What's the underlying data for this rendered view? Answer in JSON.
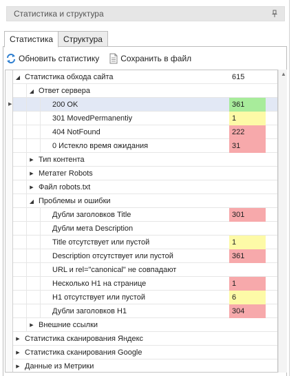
{
  "panel": {
    "title": "Статистика и структура"
  },
  "tabs": [
    {
      "label": "Статистика",
      "active": true
    },
    {
      "label": "Структура",
      "active": false
    }
  ],
  "toolbar": {
    "refresh_label": "Обновить статистику",
    "save_label": "Сохранить в файл"
  },
  "colors": {
    "green": "#a8ec9b",
    "yellow": "#fdfaa7",
    "red": "#f7a9ab",
    "selection": "#e2e8f5"
  },
  "tree": [
    {
      "level": 0,
      "expander": "expanded",
      "label": "Статистика обхода сайта",
      "value": "615",
      "color": "plain"
    },
    {
      "level": 1,
      "expander": "expanded",
      "label": "Ответ сервера",
      "value": "",
      "color": ""
    },
    {
      "level": 2,
      "expander": "",
      "label": "200 OK",
      "value": "361",
      "color": "green",
      "selected": true
    },
    {
      "level": 2,
      "expander": "",
      "label": "301 MovedPermanentiy",
      "value": "1",
      "color": "yellow"
    },
    {
      "level": 2,
      "expander": "",
      "label": "404 NotFound",
      "value": "222",
      "color": "red"
    },
    {
      "level": 2,
      "expander": "",
      "label": "0 Истекло время ожидания",
      "value": "31",
      "color": "red"
    },
    {
      "level": 1,
      "expander": "collapsed",
      "label": "Тип контента",
      "value": "",
      "color": ""
    },
    {
      "level": 1,
      "expander": "collapsed",
      "label": "Метатег Robots",
      "value": "",
      "color": ""
    },
    {
      "level": 1,
      "expander": "collapsed",
      "label": "Файл robots.txt",
      "value": "",
      "color": ""
    },
    {
      "level": 1,
      "expander": "expanded",
      "label": "Проблемы и ошибки",
      "value": "",
      "color": ""
    },
    {
      "level": 2,
      "expander": "",
      "label": "Дубли заголовков Title",
      "value": "301",
      "color": "red"
    },
    {
      "level": 2,
      "expander": "",
      "label": "Дубли мета Description",
      "value": "",
      "color": ""
    },
    {
      "level": 2,
      "expander": "",
      "label": "Title отсутствует или пустой",
      "value": "1",
      "color": "yellow"
    },
    {
      "level": 2,
      "expander": "",
      "label": "Description отсутствует или пустой",
      "value": "361",
      "color": "red"
    },
    {
      "level": 2,
      "expander": "",
      "label": "URL и rel=\"canonical\" не совпадают",
      "value": "",
      "color": ""
    },
    {
      "level": 2,
      "expander": "",
      "label": "Несколько H1 на странице",
      "value": "1",
      "color": "red"
    },
    {
      "level": 2,
      "expander": "",
      "label": "H1 отсутствует или пустой",
      "value": "6",
      "color": "yellow"
    },
    {
      "level": 2,
      "expander": "",
      "label": "Дубли заголовков H1",
      "value": "304",
      "color": "red"
    },
    {
      "level": 1,
      "expander": "collapsed",
      "label": "Внешние ссылки",
      "value": "",
      "color": ""
    },
    {
      "level": 0,
      "expander": "collapsed",
      "label": "Статистика сканирования Яндекс",
      "value": "",
      "color": ""
    },
    {
      "level": 0,
      "expander": "collapsed",
      "label": "Статистика сканирования Google",
      "value": "",
      "color": ""
    },
    {
      "level": 0,
      "expander": "collapsed",
      "label": "Данные из Метрики",
      "value": "",
      "color": ""
    }
  ]
}
